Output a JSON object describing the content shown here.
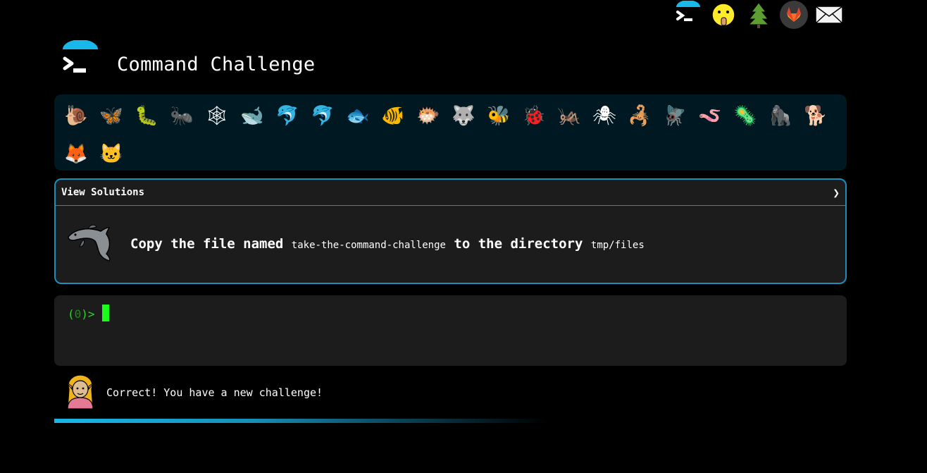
{
  "header": {
    "title": "Command Challenge"
  },
  "top_icons": [
    "terminal-umbrella-icon",
    "shushing-face-icon",
    "evergreen-tree-icon",
    "gitlab-icon",
    "envelope-icon"
  ],
  "animals": [
    {
      "name": "snail",
      "glyph": "🐌"
    },
    {
      "name": "butterfly",
      "glyph": "🦋"
    },
    {
      "name": "caterpillar",
      "glyph": "🐛"
    },
    {
      "name": "ant",
      "glyph": "🐜"
    },
    {
      "name": "spider-web",
      "glyph": "🕸"
    },
    {
      "name": "whale",
      "glyph": "🐋"
    },
    {
      "name": "dolphin-blue",
      "glyph": "🐬"
    },
    {
      "name": "dolphin-gray",
      "glyph": "🐬"
    },
    {
      "name": "fish",
      "glyph": "🐟"
    },
    {
      "name": "tropical-fish",
      "glyph": "🐠"
    },
    {
      "name": "blowfish",
      "glyph": "🐡"
    },
    {
      "name": "wolf",
      "glyph": "🐺"
    },
    {
      "name": "bee",
      "glyph": "🐝"
    },
    {
      "name": "ladybug",
      "glyph": "🐞"
    },
    {
      "name": "cricket",
      "glyph": "🦗"
    },
    {
      "name": "spider",
      "glyph": "🕷"
    },
    {
      "name": "scorpion",
      "glyph": "🦂"
    },
    {
      "name": "fly",
      "glyph": "🪰"
    },
    {
      "name": "worm",
      "glyph": "🪱"
    },
    {
      "name": "microbe",
      "glyph": "🦠"
    },
    {
      "name": "gorilla",
      "glyph": "🦍"
    },
    {
      "name": "dog",
      "glyph": "🐕"
    },
    {
      "name": "fox",
      "glyph": "🦊"
    },
    {
      "name": "cat",
      "glyph": "🐱"
    }
  ],
  "solutions": {
    "label": "View Solutions",
    "chevron": "❯"
  },
  "task": {
    "prefix": "Copy the file named",
    "file": "take-the-command-challenge",
    "middle": "to the directory",
    "dir": "tmp/files"
  },
  "terminal": {
    "prompt_open": "(",
    "prompt_num": "0",
    "prompt_close": ")>"
  },
  "message": {
    "text": "Correct! You have a new challenge!"
  },
  "colors": {
    "accent": "#1a8fb8",
    "panel": "#1c1c1c",
    "strip": "#001821",
    "prompt": "#2fd52f"
  }
}
